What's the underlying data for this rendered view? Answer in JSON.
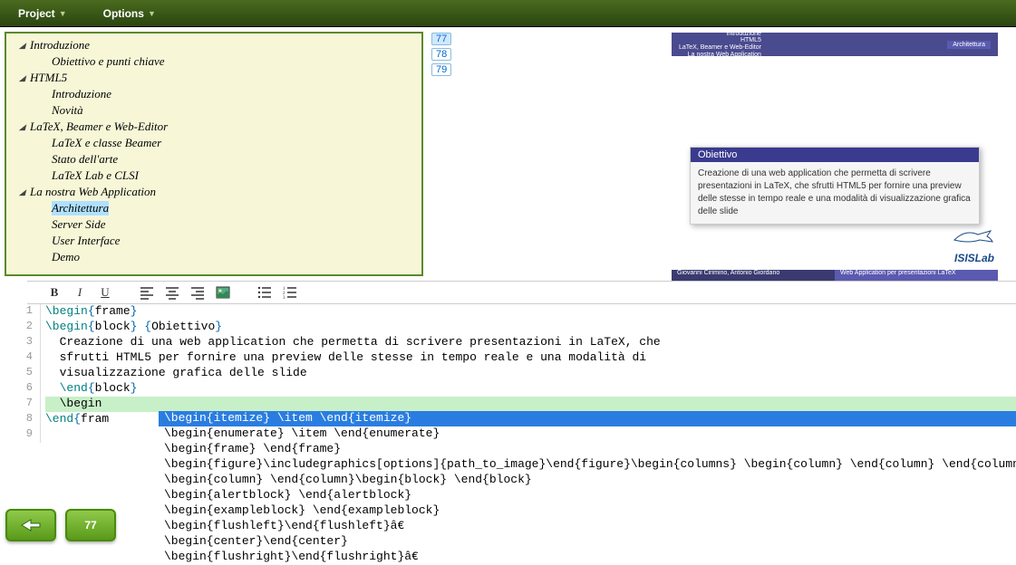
{
  "menubar": {
    "project": "Project",
    "options": "Options"
  },
  "outline": [
    {
      "level": 1,
      "label": "Introduzione",
      "expanded": true
    },
    {
      "level": 2,
      "label": "Obiettivo e punti chiave"
    },
    {
      "level": 1,
      "label": "HTML5",
      "expanded": true
    },
    {
      "level": 2,
      "label": "Introduzione"
    },
    {
      "level": 2,
      "label": "Novità"
    },
    {
      "level": 1,
      "label": "LaTeX, Beamer e Web-Editor",
      "expanded": true
    },
    {
      "level": 2,
      "label": "LaTeX e classe Beamer"
    },
    {
      "level": 2,
      "label": "Stato dell'arte"
    },
    {
      "level": 2,
      "label": "LaTeX Lab e CLSI"
    },
    {
      "level": 1,
      "label": "La nostra Web Application",
      "expanded": true
    },
    {
      "level": 2,
      "label": "Architettura",
      "selected": true
    },
    {
      "level": 2,
      "label": "Server Side"
    },
    {
      "level": 2,
      "label": "User Interface"
    },
    {
      "level": 2,
      "label": "Demo"
    }
  ],
  "pages": [
    "77",
    "78",
    "79"
  ],
  "preview": {
    "header_lines": "Introduzione\nHTML5\nLaTeX, Beamer e Web-Editor\nLa nostra Web Application",
    "header_right": "Architettura",
    "objbox_title": "Obiettivo",
    "objbox_body": "Creazione di una web application che permetta di scrivere presentazioni in LaTeX, che sfrutti HTML5 per fornire una preview delle stesse in tempo reale e una modalità di visualizzazione grafica delle slide",
    "logo_text": "ISISLab",
    "footer_left": "Giovanni Cirimino, Antonio Giordano",
    "footer_right": "Web Application per presentazioni LaTeX"
  },
  "toolbar": {
    "b": "B",
    "i": "I",
    "u": "U"
  },
  "code": {
    "lines": [
      "1",
      "2",
      "3",
      "4",
      "5",
      "6",
      "7",
      "8",
      "9"
    ],
    "l1_cmd": "\\begin",
    "l1_arg": "frame",
    "l2_cmd": "\\begin",
    "l2_arg": "block",
    "l2_arg2": "Obiettivo",
    "l3": "  Creazione di una web application che permetta di scrivere presentazioni in LaTeX, che",
    "l4": "  sfrutti HTML5 per fornire una preview delle stesse in tempo reale e una modalità di",
    "l5": "  visualizzazione grafica delle slide",
    "l6_cmd": "\\end",
    "l6_arg": "block",
    "l7": "  \\begin",
    "l8_cmd": "\\end",
    "l8_arg": "fram"
  },
  "autocomplete": [
    "\\begin{itemize} \\item \\end{itemize}",
    "\\begin{enumerate} \\item \\end{enumerate}",
    "\\begin{frame} \\end{frame}",
    "\\begin{figure}\\includegraphics[options]{path_to_image}\\end{figure}\\begin{columns} \\begin{column} \\end{column} \\end{columns}",
    "\\begin{column} \\end{column}\\begin{block} \\end{block}",
    "\\begin{alertblock} \\end{alertblock}",
    "\\begin{exampleblock} \\end{exampleblock}",
    "\\begin{flushleft}\\end{flushleft}â€",
    "\\begin{center}\\end{center}",
    "\\begin{flushright}\\end{flushright}â€"
  ],
  "footer": {
    "page": "77"
  }
}
